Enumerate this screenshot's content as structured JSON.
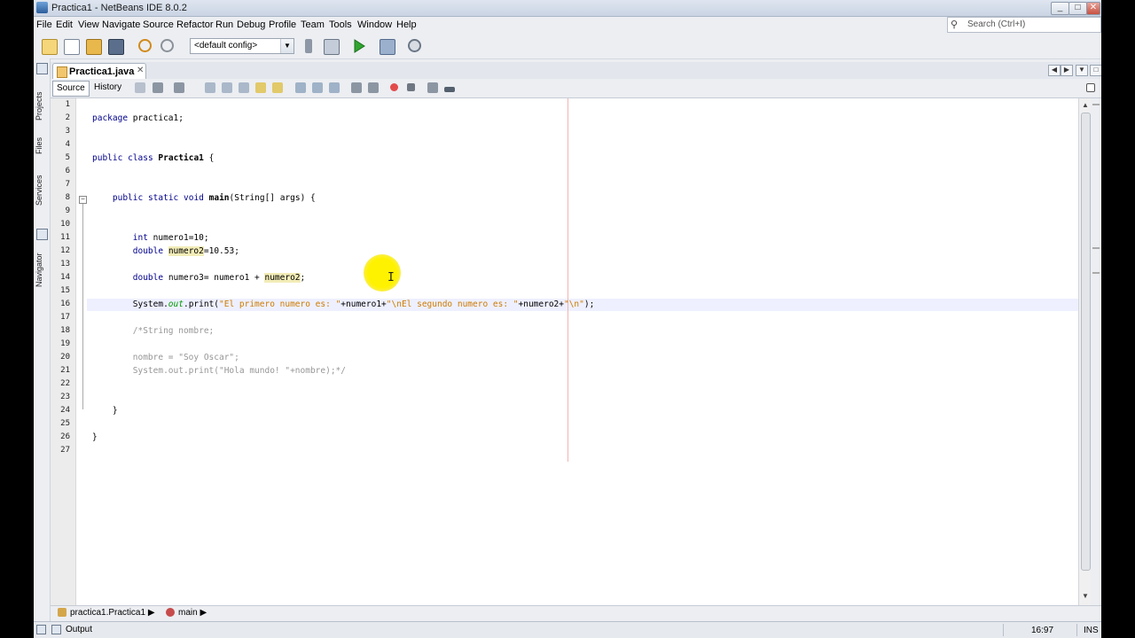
{
  "window": {
    "title": "Practica1 - NetBeans IDE 8.0.2",
    "controls": [
      "_",
      "□",
      "✕"
    ]
  },
  "menu": [
    "File",
    "Edit",
    "View",
    "Navigate",
    "Source",
    "Refactor",
    "Run",
    "Debug",
    "Profile",
    "Team",
    "Tools",
    "Window",
    "Help"
  ],
  "search": {
    "placeholder": "Search (Ctrl+I)"
  },
  "toolbar": {
    "config": "<default config>",
    "icons": [
      "new-project-icon",
      "new-file-icon",
      "open-project-icon",
      "save-all-icon",
      "undo-icon",
      "redo-icon",
      "build-icon",
      "clean-build-icon",
      "run-icon",
      "debug-icon",
      "profile-icon"
    ]
  },
  "side_tabs": [
    "Projects",
    "Files",
    "Services",
    "Navigator"
  ],
  "tab": {
    "label": "Practica1.java",
    "close": "✕"
  },
  "editor_toolbar": {
    "source": "Source",
    "history": "History"
  },
  "code_lines": [
    {
      "n": "1",
      "html": ""
    },
    {
      "n": "2",
      "html": "<span class='kw'>package</span> practica1;"
    },
    {
      "n": "3",
      "html": ""
    },
    {
      "n": "4",
      "html": ""
    },
    {
      "n": "5",
      "html": "<span class='kw'>public</span> <span class='kw'>class</span> <span class='bold'>Practica1</span> {"
    },
    {
      "n": "6",
      "html": ""
    },
    {
      "n": "7",
      "html": ""
    },
    {
      "n": "8",
      "html": "    <span class='kw'>public</span> <span class='kw'>static</span> <span class='kw'>void</span> <span class='bold'>main</span>(String[] args) {"
    },
    {
      "n": "9",
      "html": ""
    },
    {
      "n": "10",
      "html": ""
    },
    {
      "n": "11",
      "html": "        <span class='kw'>int</span> numero1=10;"
    },
    {
      "n": "12",
      "html": "        <span class='kw'>double</span> <span class='hl'>numero2</span>=10.53;"
    },
    {
      "n": "13",
      "html": ""
    },
    {
      "n": "14",
      "html": "        <span class='kw'>double</span> numero3= numero1 + <span class='hl'>numero2</span>;"
    },
    {
      "n": "15",
      "html": ""
    },
    {
      "n": "16",
      "html": "        System.<span class='fld'>out</span>.print(<span class='str'>\"El primero numero es: \"</span>+numero1+<span class='str'>\"\\nEl segundo numero es: \"</span>+numero2+<span class='str'>\"\\n\"</span>);"
    },
    {
      "n": "17",
      "html": ""
    },
    {
      "n": "18",
      "html": "        <span class='cmt'>/*String nombre;</span>"
    },
    {
      "n": "19",
      "html": ""
    },
    {
      "n": "20",
      "html": "        <span class='cmt'>nombre = \"Soy Oscar\";</span>"
    },
    {
      "n": "21",
      "html": "        <span class='cmt'>System.out.print(\"Hola mundo! \"+nombre);*/</span>"
    },
    {
      "n": "22",
      "html": ""
    },
    {
      "n": "23",
      "html": ""
    },
    {
      "n": "24",
      "html": "    }"
    },
    {
      "n": "25",
      "html": ""
    },
    {
      "n": "26",
      "html": "}"
    },
    {
      "n": "27",
      "html": ""
    }
  ],
  "breadcrumb": {
    "class": "practica1.Practica1",
    "method": "main"
  },
  "status": {
    "output": "Output",
    "position": "16:97",
    "mode": "INS"
  }
}
